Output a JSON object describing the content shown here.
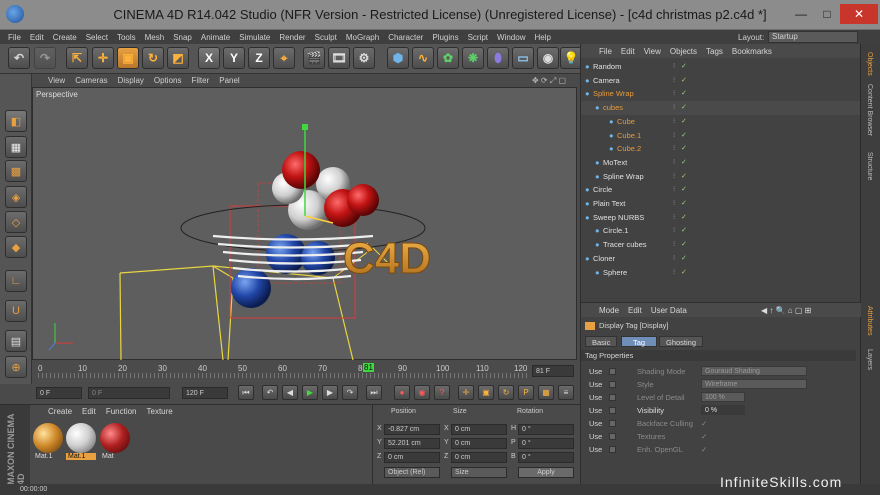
{
  "window": {
    "title": "CINEMA 4D R14.042 Studio (NFR Version - Restricted License) (Unregistered License) - [c4d christmas p2.c4d *]",
    "minimize": "—",
    "maximize": "□",
    "close": "✕"
  },
  "menubar": [
    "File",
    "Edit",
    "Create",
    "Select",
    "Tools",
    "Mesh",
    "Snap",
    "Animate",
    "Simulate",
    "Render",
    "Sculpt",
    "MoGraph",
    "Character",
    "Plugins",
    "Script",
    "Window",
    "Help"
  ],
  "layout": {
    "label": "Layout:",
    "value": "Startup"
  },
  "toolbar_axes": [
    "X",
    "Y",
    "Z"
  ],
  "viewport": {
    "menu": [
      "View",
      "Cameras",
      "Display",
      "Options",
      "Filter",
      "Panel"
    ],
    "label": "Perspective",
    "text3d": "C4D"
  },
  "timeline": {
    "ticks": [
      "0",
      "10",
      "20",
      "30",
      "40",
      "50",
      "60",
      "70",
      "80",
      "81",
      "90",
      "100",
      "110",
      "120"
    ],
    "current_frame": "81 F",
    "start_field": "0 F",
    "min_field": "0 F",
    "max_field": "120 F",
    "end_field": "120 F"
  },
  "materials": {
    "menu": [
      "Create",
      "Edit",
      "Function",
      "Texture"
    ],
    "items": [
      {
        "label": "Mat.1",
        "color": "#d08a2a"
      },
      {
        "label": "Mat.1",
        "color": "#d8d8d8"
      },
      {
        "label": "Mat",
        "color": "#b02020"
      }
    ]
  },
  "coords": {
    "headers": {
      "position": "Position",
      "size": "Size",
      "rotation": "Rotation"
    },
    "rows": [
      {
        "axis": "X",
        "pos": "-0.827 cm",
        "size": "0 cm",
        "rlabel": "H",
        "rot": "0 °"
      },
      {
        "axis": "Y",
        "pos": "52.201 cm",
        "size": "0 cm",
        "rlabel": "P",
        "rot": "0 °"
      },
      {
        "axis": "Z",
        "pos": "0 cm",
        "size": "0 cm",
        "rlabel": "B",
        "rot": "0 °"
      }
    ],
    "mode": "Object (Rel)",
    "size_mode": "Size",
    "apply": "Apply"
  },
  "status": "00:00:00",
  "objects": {
    "menu": [
      "File",
      "Edit",
      "View",
      "Objects",
      "Tags",
      "Bookmarks"
    ],
    "items": [
      {
        "name": "Random",
        "indent": 12,
        "color": "#e0e0e0"
      },
      {
        "name": "Camera",
        "indent": 12,
        "color": "#e0e0e0"
      },
      {
        "name": "Spline Wrap",
        "indent": 12,
        "color": "#e79a3c"
      },
      {
        "name": "cubes",
        "indent": 22,
        "color": "#e79a3c"
      },
      {
        "name": "Cube",
        "indent": 36,
        "color": "#e79a3c"
      },
      {
        "name": "Cube.1",
        "indent": 36,
        "color": "#e79a3c"
      },
      {
        "name": "Cube.2",
        "indent": 36,
        "color": "#e79a3c"
      },
      {
        "name": "MoText",
        "indent": 22,
        "color": "#e0e0e0"
      },
      {
        "name": "Spline Wrap",
        "indent": 22,
        "color": "#e0e0e0"
      },
      {
        "name": "Circle",
        "indent": 12,
        "color": "#e0e0e0"
      },
      {
        "name": "Plain Text",
        "indent": 12,
        "color": "#e0e0e0"
      },
      {
        "name": "Sweep NURBS",
        "indent": 12,
        "color": "#e0e0e0"
      },
      {
        "name": "Circle.1",
        "indent": 22,
        "color": "#e0e0e0"
      },
      {
        "name": "Tracer cubes",
        "indent": 22,
        "color": "#e0e0e0"
      },
      {
        "name": "Cloner",
        "indent": 12,
        "color": "#e0e0e0"
      },
      {
        "name": "Sphere",
        "indent": 22,
        "color": "#e0e0e0"
      }
    ]
  },
  "attributes": {
    "menu": [
      "Mode",
      "Edit",
      "User Data"
    ],
    "title": "Display Tag [Display]",
    "tabs": [
      "Basic",
      "Tag",
      "Ghosting"
    ],
    "section": "Tag Properties",
    "use_label": "Use",
    "props": [
      {
        "label": "Shading Mode",
        "value": "Gouraud Shading"
      },
      {
        "label": "Style",
        "value": "Wireframe"
      },
      {
        "label": "Level of Detail",
        "value": "100 %"
      },
      {
        "label": "Visibility",
        "value": "0 %"
      },
      {
        "label": "Backface Culling",
        "value": "✓"
      },
      {
        "label": "Textures",
        "value": "✓"
      },
      {
        "label": "Enh. OpenGL",
        "value": "✓"
      }
    ]
  },
  "side_tabs": [
    "Objects",
    "Content Browser",
    "Structure",
    "Attributes",
    "Layers"
  ],
  "brand": {
    "vertical": "MAXON CINEMA 4D"
  },
  "watermark": "InfiniteSkills.com"
}
